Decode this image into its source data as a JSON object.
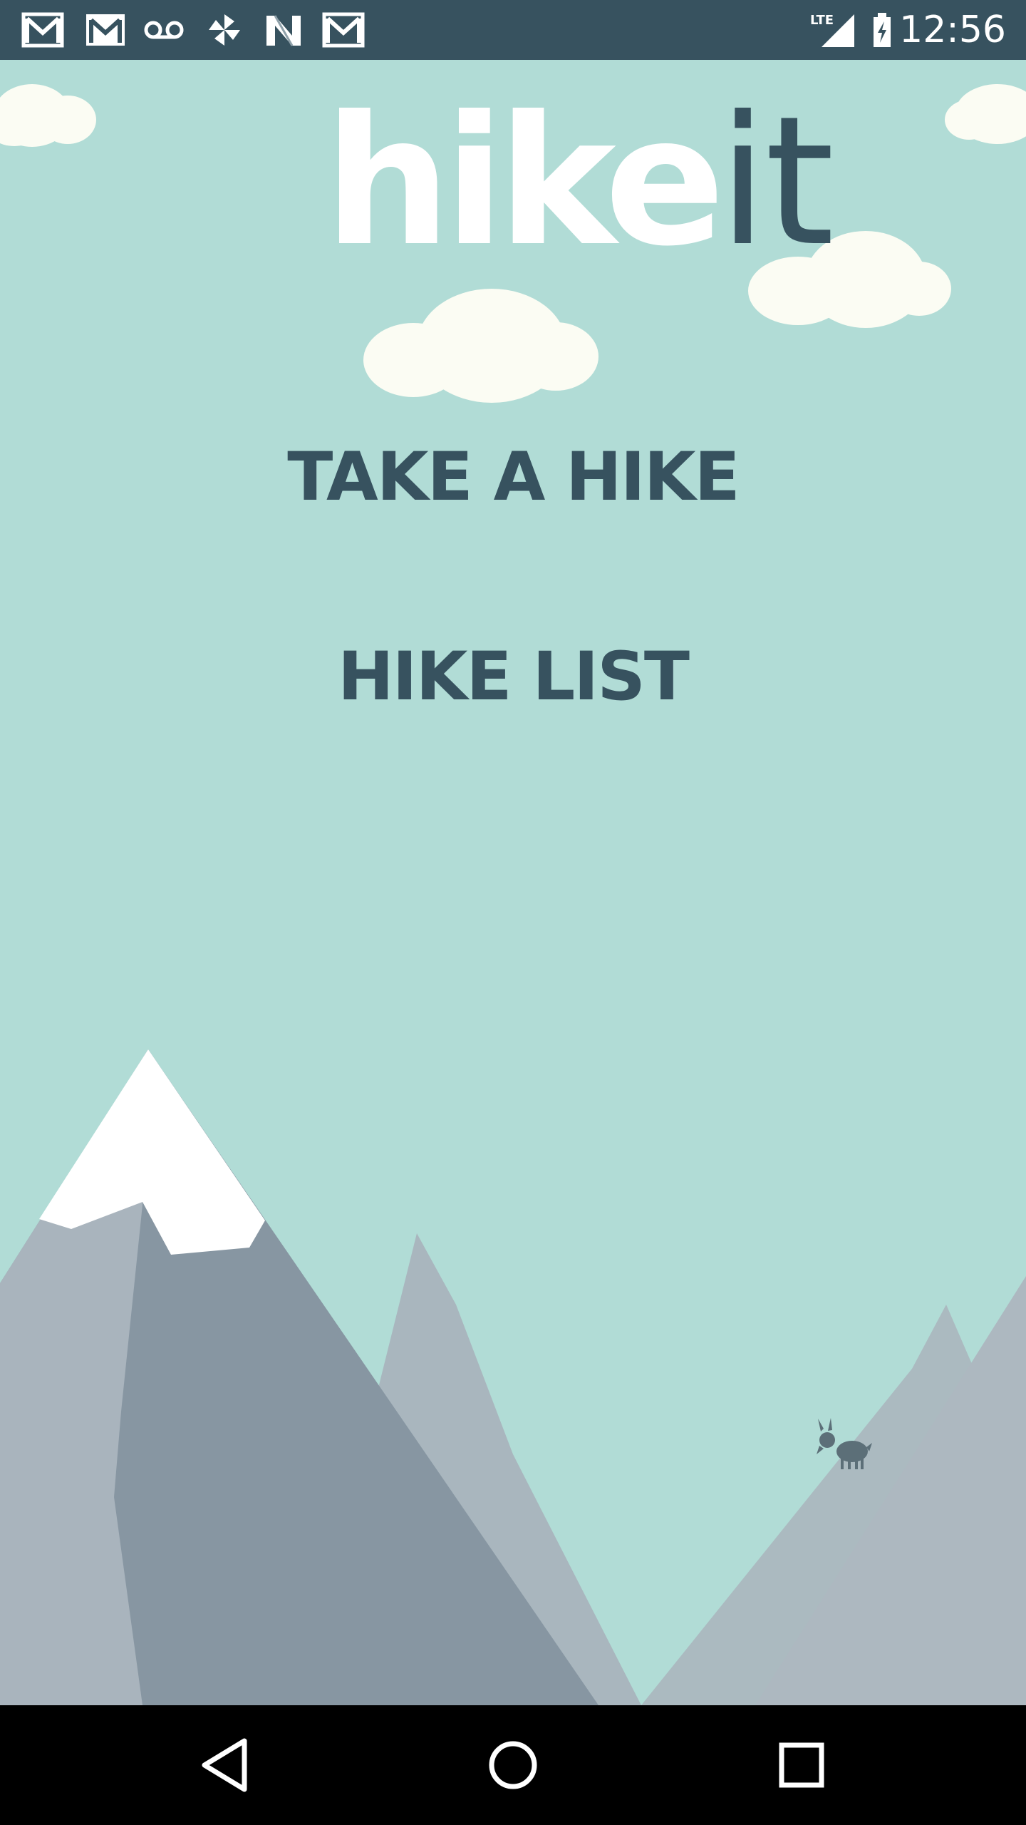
{
  "app": {
    "logo_primary": "hike",
    "logo_secondary": "it"
  },
  "status_bar": {
    "time": "12:56",
    "notification_icons": [
      "gmail-icon",
      "gmail-icon",
      "voicemail-icon",
      "pinwheel-icon",
      "n-app-icon",
      "gmail-icon"
    ],
    "network_label": "LTE"
  },
  "menu": {
    "take_hike_label": "TAKE A HIKE",
    "hike_list_label": "HIKE LIST"
  },
  "nav_bar": {
    "icons": [
      "back-icon",
      "home-icon",
      "recents-icon"
    ]
  },
  "colors": {
    "sky": "#b1dcd6",
    "dark_slate": "#37525f",
    "white": "#ffffff"
  }
}
